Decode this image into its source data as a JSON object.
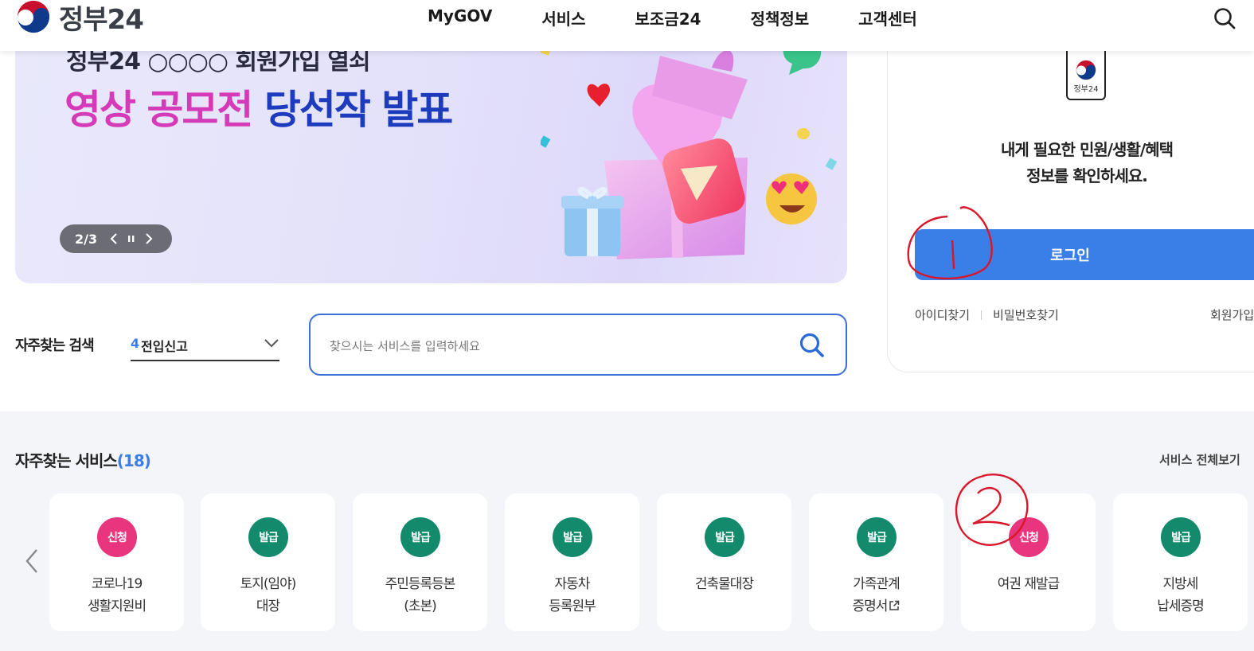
{
  "header": {
    "logo_text": "정부24",
    "nav": [
      "MyGOV",
      "서비스",
      "보조금24",
      "정책정보",
      "고객센터"
    ],
    "search_icon": "search-icon"
  },
  "banner": {
    "subtitle": "정부24 ○○○○ 회원가입 열쇠",
    "title_pink": "영상 공모전",
    "title_blue": "당선작 발표",
    "pager": {
      "count": "2/3"
    }
  },
  "login": {
    "app_icon_label": "정부24",
    "message_line1": "내게 필요한 민원/생활/혜택",
    "message_line2": "정보를 확인하세요.",
    "button": "로그인",
    "find_id": "아이디찾기",
    "find_pw": "비밀번호찾기",
    "join": "회원가입"
  },
  "frequent_search": {
    "label": "자주찾는 검색",
    "selected_num": "4",
    "selected_text": "전입신고",
    "placeholder": "찾으시는 서비스를 입력하세요"
  },
  "services": {
    "title": "자주찾는 서비스",
    "count_text": "(18)",
    "view_all": "서비스 전체보기",
    "cards": [
      {
        "badge": "신청",
        "type": "apply",
        "line1": "코로나19",
        "line2": "생활지원비"
      },
      {
        "badge": "발급",
        "type": "issue",
        "line1": "토지(임야)",
        "line2": "대장"
      },
      {
        "badge": "발급",
        "type": "issue",
        "line1": "주민등록등본",
        "line2": "(초본)"
      },
      {
        "badge": "발급",
        "type": "issue",
        "line1": "자동차",
        "line2": "등록원부"
      },
      {
        "badge": "발급",
        "type": "issue",
        "line1": "건축물대장",
        "line2": ""
      },
      {
        "badge": "발급",
        "type": "issue",
        "line1": "가족관계",
        "line2": "증명서"
      },
      {
        "badge": "신청",
        "type": "apply",
        "line1": "여권 재발급",
        "line2": ""
      },
      {
        "badge": "발급",
        "type": "issue",
        "line1": "지방세",
        "line2": "납세증명"
      }
    ]
  },
  "annotations": {
    "mark1": "1",
    "mark2": "2",
    "color": "#d9162a"
  },
  "colors": {
    "primary_blue": "#3a7ee8",
    "apply_pink": "#e8357d",
    "issue_green": "#138a6c"
  }
}
